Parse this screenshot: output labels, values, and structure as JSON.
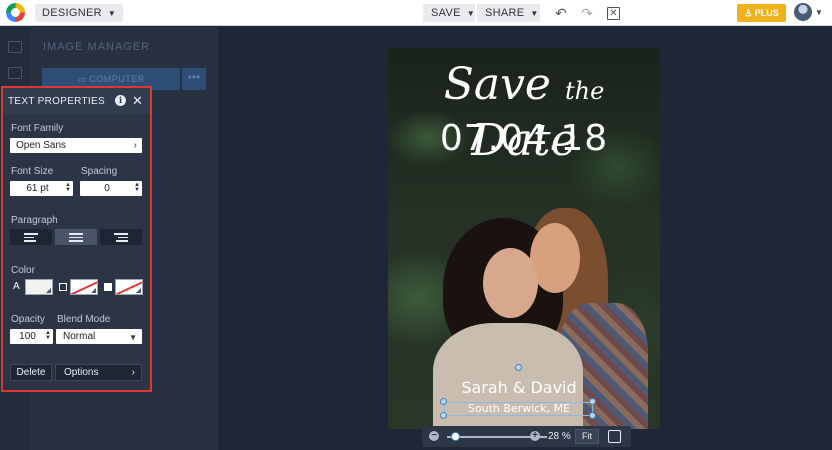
{
  "topbar": {
    "mode": "DESIGNER",
    "save_label": "SAVE",
    "share_label": "SHARE",
    "plus_label": "PLUS"
  },
  "image_manager": {
    "title": "IMAGE MANAGER",
    "computer_label": "COMPUTER",
    "more_label": "•••"
  },
  "text_properties": {
    "title": "TEXT PROPERTIES",
    "font_family_label": "Font Family",
    "font_family_value": "Open Sans",
    "font_size_label": "Font Size",
    "font_size_value": "61 pt",
    "spacing_label": "Spacing",
    "spacing_value": "0",
    "paragraph_label": "Paragraph",
    "align_active": "center",
    "color_label": "Color",
    "color_a_glyph": "A",
    "opacity_label": "Opacity",
    "opacity_value": "100",
    "blend_mode_label": "Blend Mode",
    "blend_mode_value": "Normal",
    "delete_label": "Delete",
    "options_label": "Options"
  },
  "canvas": {
    "title_main": "Save",
    "title_connector": "the",
    "title_end": "Date",
    "date": "07.04.18",
    "names": "Sarah & David",
    "place": "South Berwick, ME"
  },
  "zoom": {
    "level": "28 %",
    "fit_label": "Fit",
    "value": 0.28
  },
  "colors": {
    "accent_plus": "#f0b21c",
    "panel_highlight": "#e3352f",
    "panel_bg": "#2c3546",
    "app_bg": "#1f2736"
  }
}
